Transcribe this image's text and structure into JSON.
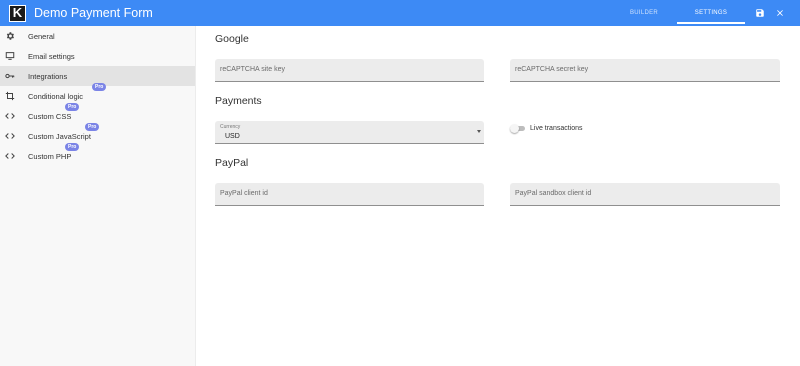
{
  "app": {
    "logo_letter": "K",
    "title": "Demo Payment Form",
    "accent_color": "#3d8af5"
  },
  "header": {
    "tabs": [
      {
        "label": "BUILDER",
        "active": false
      },
      {
        "label": "SETTINGS",
        "active": true
      }
    ],
    "icons": [
      "save-icon",
      "close-icon"
    ]
  },
  "sidebar": {
    "items": [
      {
        "label": "General",
        "icon": "gear-icon",
        "pro": false,
        "active": false
      },
      {
        "label": "Email settings",
        "icon": "monitor-icon",
        "pro": false,
        "active": false
      },
      {
        "label": "Integrations",
        "icon": "key-icon",
        "pro": false,
        "active": true
      },
      {
        "label": "Conditional logic",
        "icon": "crop-icon",
        "pro": true,
        "active": false
      },
      {
        "label": "Custom CSS",
        "icon": "code-icon",
        "pro": true,
        "active": false
      },
      {
        "label": "Custom JavaScript",
        "icon": "code-icon",
        "pro": true,
        "active": false
      },
      {
        "label": "Custom PHP",
        "icon": "code-icon",
        "pro": true,
        "active": false
      }
    ],
    "pro_badge": "Pro"
  },
  "main": {
    "google": {
      "title": "Google",
      "site_key_placeholder": "reCAPTCHA site key",
      "secret_key_placeholder": "reCAPTCHA secret key"
    },
    "payments": {
      "title": "Payments",
      "currency_label": "Currency",
      "currency_value": "USD",
      "live_label": "Live transactions",
      "live_enabled": false
    },
    "paypal": {
      "title": "PayPal",
      "client_id_placeholder": "PayPal client id",
      "sandbox_client_id_placeholder": "PayPal sandbox client id"
    }
  }
}
